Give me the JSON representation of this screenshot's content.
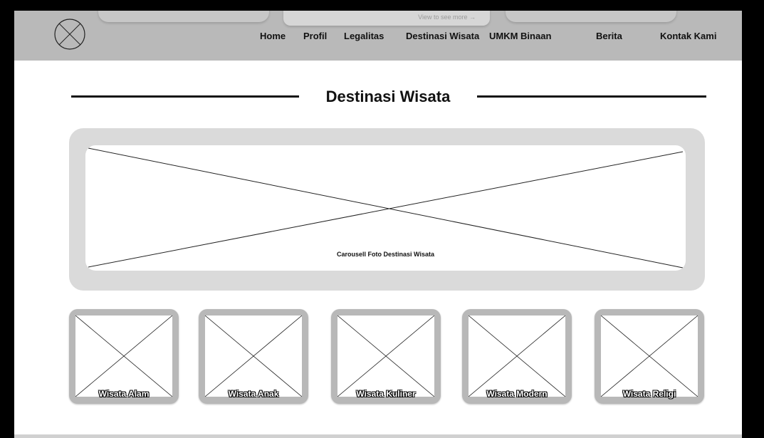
{
  "header": {
    "ghost_hint": "View to see more →",
    "logo_icon": "image-placeholder-icon",
    "nav": [
      "Home",
      "Profil",
      "Legalitas",
      "Destinasi Wisata",
      "UMKM Binaan",
      "Berita",
      "Kontak Kami"
    ]
  },
  "main": {
    "title": "Destinasi Wisata",
    "carousel_caption": "Carousell Foto Destinasi Wisata",
    "categories": [
      "Wisata Alam",
      "Wisata Anak",
      "Wisata Kuliner",
      "Wisata Modern",
      "Wisata Religi"
    ]
  },
  "colors": {
    "header_bg": "#b9b9b9",
    "frame_bg": "#dadada",
    "card_bg": "#b8b8b8",
    "text": "#111111"
  }
}
